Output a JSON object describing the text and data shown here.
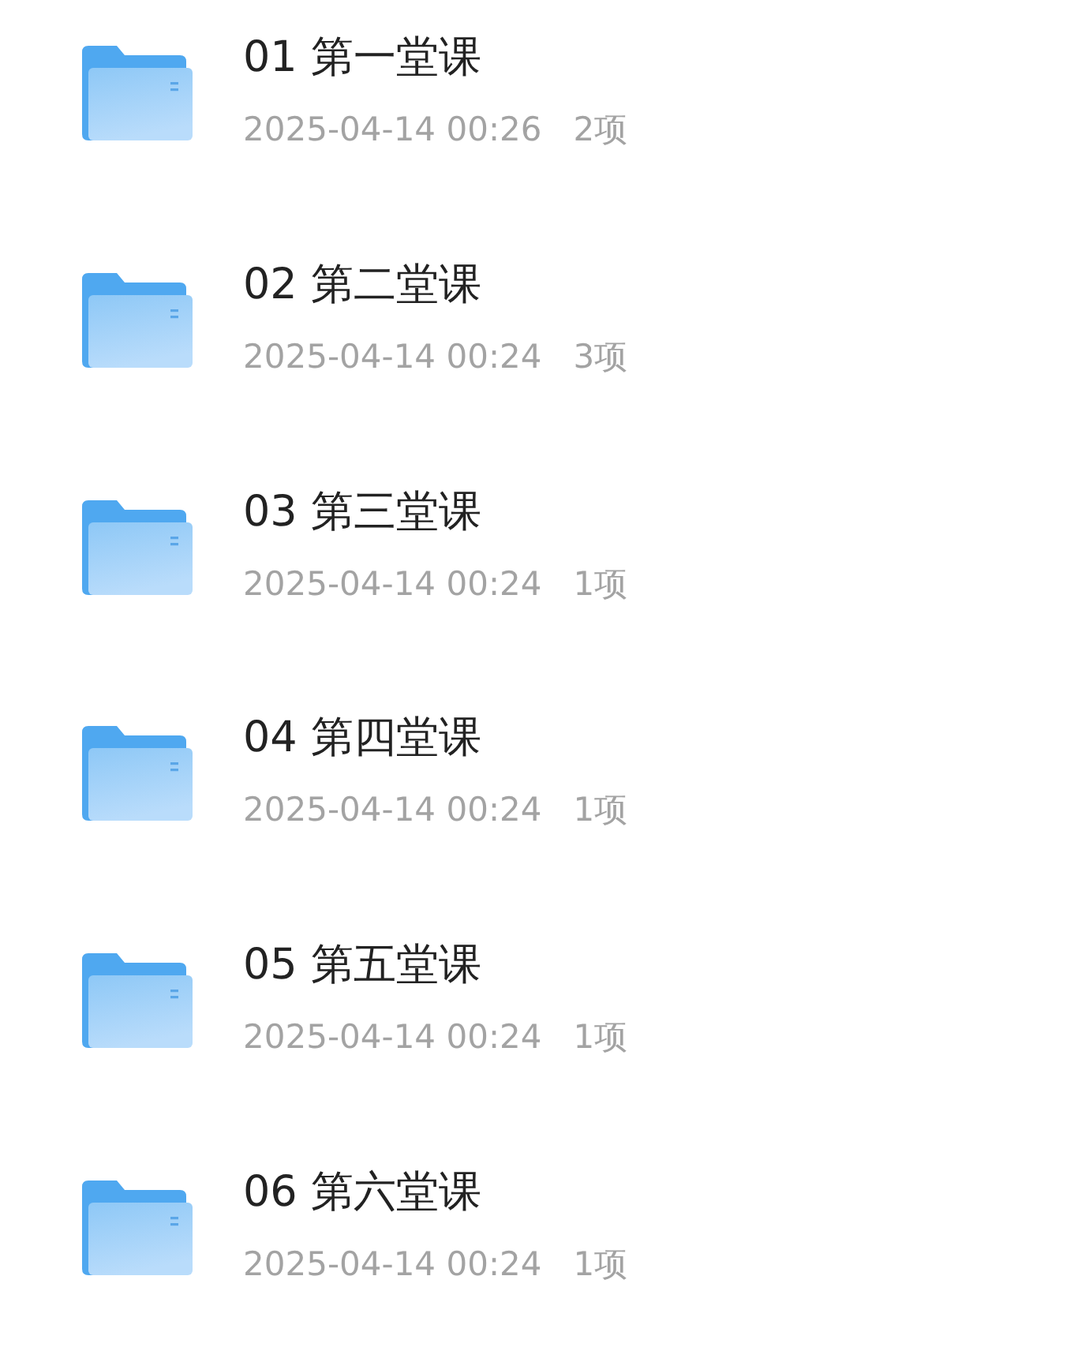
{
  "folders": [
    {
      "name": "01 第一堂课",
      "date": "2025-04-14 00:26",
      "count": "2项"
    },
    {
      "name": "02 第二堂课",
      "date": "2025-04-14 00:24",
      "count": "3项"
    },
    {
      "name": "03 第三堂课",
      "date": "2025-04-14 00:24",
      "count": "1项"
    },
    {
      "name": "04 第四堂课",
      "date": "2025-04-14 00:24",
      "count": "1项"
    },
    {
      "name": "05 第五堂课",
      "date": "2025-04-14 00:24",
      "count": "1项"
    },
    {
      "name": "06 第六堂课",
      "date": "2025-04-14 00:24",
      "count": "1项"
    }
  ]
}
